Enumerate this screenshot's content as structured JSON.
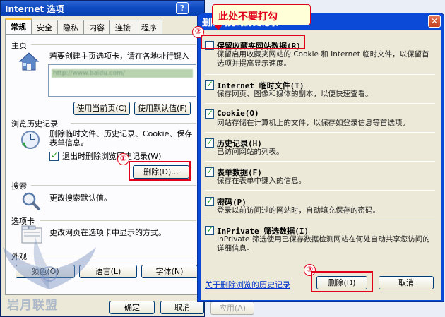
{
  "io": {
    "title": "Internet 选项",
    "help_btn": "?",
    "close_btn": "✕",
    "tabs": [
      "常规",
      "安全",
      "隐私",
      "内容",
      "连接",
      "程序"
    ],
    "home": {
      "section": "主页",
      "desc": "若要创建主页选项卡，请在各地址行键入",
      "url": "http://www.baidu.com/",
      "use_current": "使用当前页(C)",
      "use_default": "使用默认值(F)"
    },
    "history": {
      "section": "浏览历史记录",
      "desc_line1": "删除临时文件、历史记录、Cookie、保存",
      "desc_line2": "表单信息。",
      "exit_delete": "退出时删除浏览历史记录(W)",
      "delete_btn": "删除(D)..."
    },
    "search": {
      "section": "搜索",
      "desc": "更改搜索默认值。"
    },
    "tabs_section": {
      "section": "选项卡",
      "desc": "更改网页在选项卡中显示的方式。"
    },
    "appearance": {
      "section": "外观",
      "colors": "颜色(O)",
      "languages": "语言(L)",
      "fonts": "字体(N)"
    },
    "ok": "确定",
    "cancel": "取消",
    "apply": "应用(A)"
  },
  "dialog": {
    "title": "删除浏览的历史记录",
    "close_btn": "✕",
    "options": [
      {
        "title": "保留收藏夹网站数据(R)",
        "desc": "保留启用收藏夹网站的 Cookie 和 Internet 临时文件，以保留首选项并提高显示速度。",
        "checked": false
      },
      {
        "title": "Internet 临时文件(T)",
        "desc": "保存网页、图像和媒体的副本，以便快速查看。",
        "checked": true
      },
      {
        "title": "Cookie(O)",
        "desc": "网站存储在计算机上的文件，以保存如登录信息等首选项。",
        "checked": true
      },
      {
        "title": "历史记录(H)",
        "desc": "已访问网站的列表。",
        "checked": true
      },
      {
        "title": "表单数据(F)",
        "desc": "保存在表单中键入的信息。",
        "checked": true
      },
      {
        "title": "密码(P)",
        "desc": "登录以前访问过的网站时，自动填充保存的密码。",
        "checked": true
      },
      {
        "title": "InPrivate 筛选数据(I)",
        "desc": "InPrivate 筛选使用已保存数据检测网站在何处自动共享您访问的详细信息。",
        "checked": true
      }
    ],
    "about_link": "关于删除浏览的历史记录",
    "delete_btn": "删除(D)",
    "cancel_btn": "取消"
  },
  "annotations": {
    "callout": "此处不要打勾",
    "step1": "①",
    "step2": "②",
    "step3": "③"
  },
  "watermark": {
    "name": "岩月联盟"
  }
}
